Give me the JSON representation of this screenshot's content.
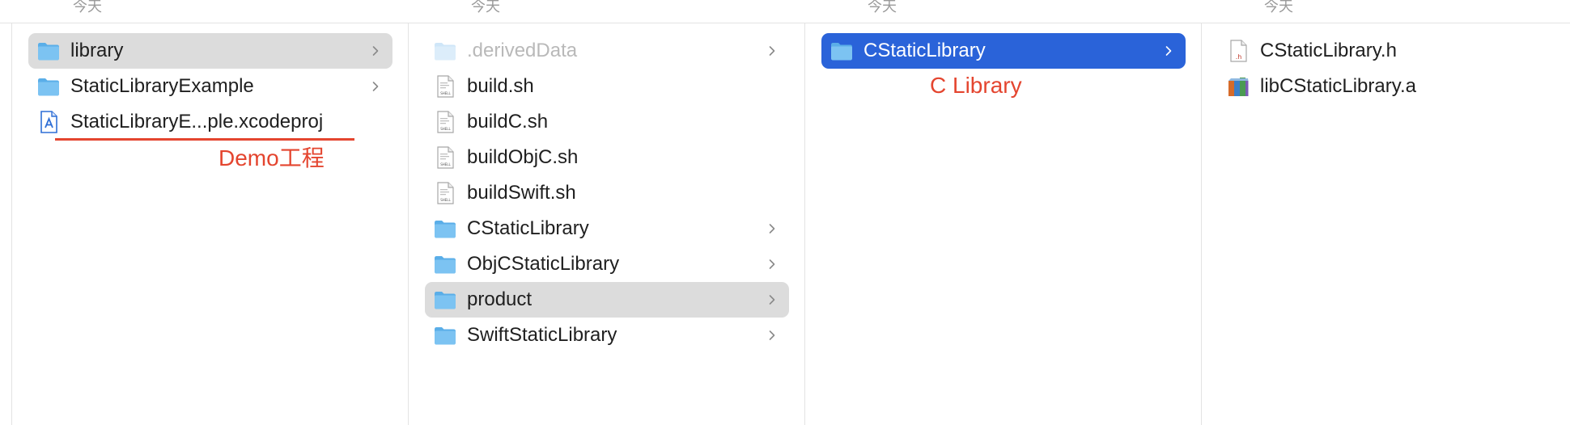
{
  "header": {
    "col1": "今天",
    "col2": "今天",
    "col3": "今天",
    "col4": "今天"
  },
  "columns": {
    "col1": [
      {
        "label": "library",
        "icon": "folder-icon",
        "chevron": true,
        "selected": "grey"
      },
      {
        "label": "StaticLibraryExample",
        "icon": "folder-icon",
        "chevron": true
      },
      {
        "label": "StaticLibraryE...ple.xcodeproj",
        "icon": "xcodeproj-icon",
        "chevron": false
      }
    ],
    "col2": [
      {
        "label": ".derivedData",
        "icon": "folder-icon",
        "chevron": true,
        "dim": true
      },
      {
        "label": "build.sh",
        "icon": "shell-script-icon",
        "chevron": false
      },
      {
        "label": "buildC.sh",
        "icon": "shell-script-icon",
        "chevron": false
      },
      {
        "label": "buildObjC.sh",
        "icon": "shell-script-icon",
        "chevron": false
      },
      {
        "label": "buildSwift.sh",
        "icon": "shell-script-icon",
        "chevron": false
      },
      {
        "label": "CStaticLibrary",
        "icon": "folder-icon",
        "chevron": true
      },
      {
        "label": "ObjCStaticLibrary",
        "icon": "folder-icon",
        "chevron": true
      },
      {
        "label": "product",
        "icon": "folder-icon",
        "chevron": true,
        "selected": "grey"
      },
      {
        "label": "SwiftStaticLibrary",
        "icon": "folder-icon",
        "chevron": true
      }
    ],
    "col3": [
      {
        "label": "CStaticLibrary",
        "icon": "folder-icon",
        "chevron": true,
        "selected": "blue"
      }
    ],
    "col4": [
      {
        "label": "CStaticLibrary.h",
        "icon": "header-file-icon",
        "chevron": false
      },
      {
        "label": "libCStaticLibrary.a",
        "icon": "static-library-icon",
        "chevron": false
      }
    ]
  },
  "annotations": {
    "demo": "Demo工程",
    "clib": "C Library"
  },
  "colors": {
    "accent": "#2a63d9",
    "annotation": "#e4452f",
    "selection_grey": "#dcdcdc",
    "folder": "#6bb8ec"
  }
}
